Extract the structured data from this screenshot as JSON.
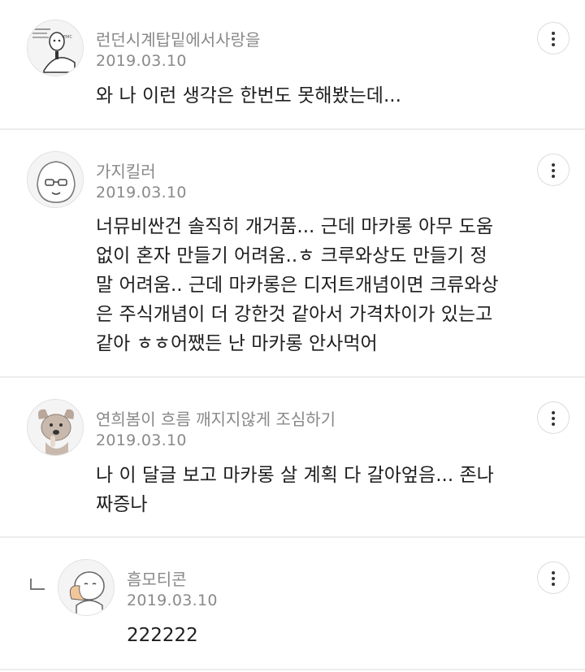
{
  "comments": [
    {
      "author": "런던시계탑밑에서사랑을",
      "date": "2019.03.10",
      "lines": [
        "와 나 이런 생각은 한번도 못해봤는데..."
      ]
    },
    {
      "author": "가지킬러",
      "date": "2019.03.10",
      "lines": [
        "너뮤비싼건 솔직히 개거품... 근데 마카롱 아무 도움",
        "없이 혼자 만들기 어려움..ㅎ 크루와상도 만들기 정",
        "말 어려움.. 근데 마카롱은 디저트개념이면 크류와상",
        "은 주식개념이 더 강한것 같아서 가격차이가 있는고",
        "같아 ㅎㅎ어쨌든 난 마카롱 안사먹어"
      ]
    },
    {
      "author": "연희봄이 흐름 깨지지않게 조심하기",
      "date": "2019.03.10",
      "lines": [
        "나 이 달글 보고 마카롱 살 계획 다 갈아엎음... 존나",
        "짜증나"
      ]
    },
    {
      "author": "흠모티콘",
      "date": "2019.03.10",
      "lines": [
        "222222"
      ]
    }
  ],
  "icons": {
    "more": "more-vertical-icon",
    "reply": "reply-arrow-icon"
  }
}
